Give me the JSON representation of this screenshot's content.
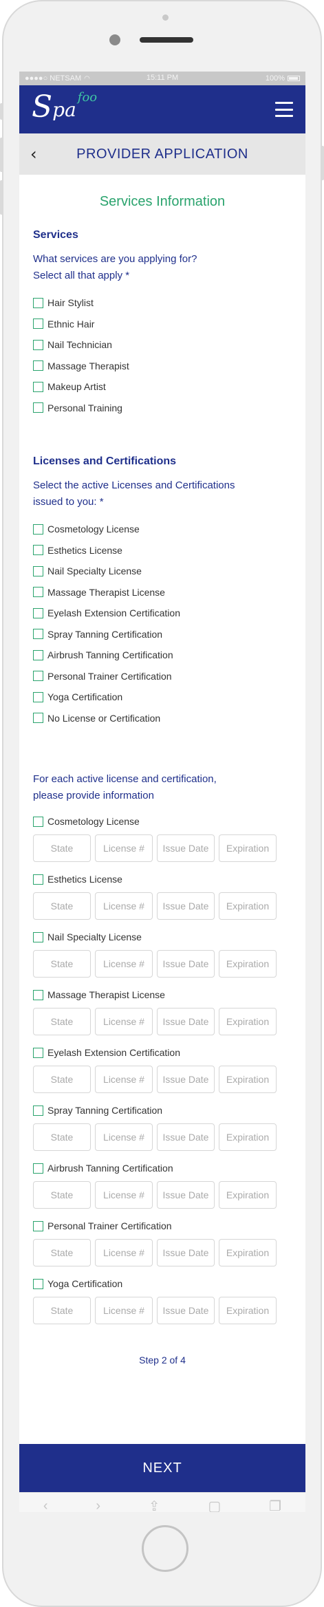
{
  "status": {
    "carrier": "●●●●○ NETSAM",
    "time": "15:11 PM",
    "battery": "100%"
  },
  "app": {
    "logo_s": "S",
    "logo_pa": "pa",
    "logo_foo": "foo"
  },
  "header": {
    "title": "PROVIDER APPLICATION"
  },
  "section_title": "Services Information",
  "services": {
    "heading": "Services",
    "prompt_line1": "What services are you applying for?",
    "prompt_line2": "Select all that apply *",
    "options": [
      "Hair Stylist",
      "Ethnic Hair",
      "Nail Technician",
      "Massage Therapist",
      "Makeup Artist",
      "Personal Training"
    ]
  },
  "licenses": {
    "heading": "Licenses and Certifications",
    "prompt_line1": "Select the active Licenses and Certifications",
    "prompt_line2": "issued to you: *",
    "options": [
      "Cosmetology License",
      "Esthetics License",
      "Nail Specialty License",
      "Massage Therapist License",
      "Eyelash Extension Certification",
      "Spray Tanning Certification",
      "Airbrush Tanning Certification",
      "Personal Trainer Certification",
      "Yoga Certification",
      "No License or Certification"
    ]
  },
  "license_info": {
    "prompt_line1": "For each active license and certification,",
    "prompt_line2": "please provide information",
    "fields": {
      "state": "State",
      "number": "License #",
      "issue": "Issue Date",
      "expiration": "Expiration"
    },
    "items": [
      "Cosmetology License",
      "Esthetics License",
      "Nail Specialty License",
      "Massage Therapist License",
      "Eyelash Extension Certification",
      "Spray Tanning Certification",
      "Airbrush Tanning Certification",
      "Personal Trainer Certification",
      "Yoga Certification"
    ]
  },
  "footer": {
    "step": "Step 2 of 4",
    "next": "NEXT"
  },
  "browser_toolbar": {
    "back": "‹",
    "forward": "›",
    "share": "⇪",
    "bookmarks": "▢",
    "tabs": "❐"
  }
}
